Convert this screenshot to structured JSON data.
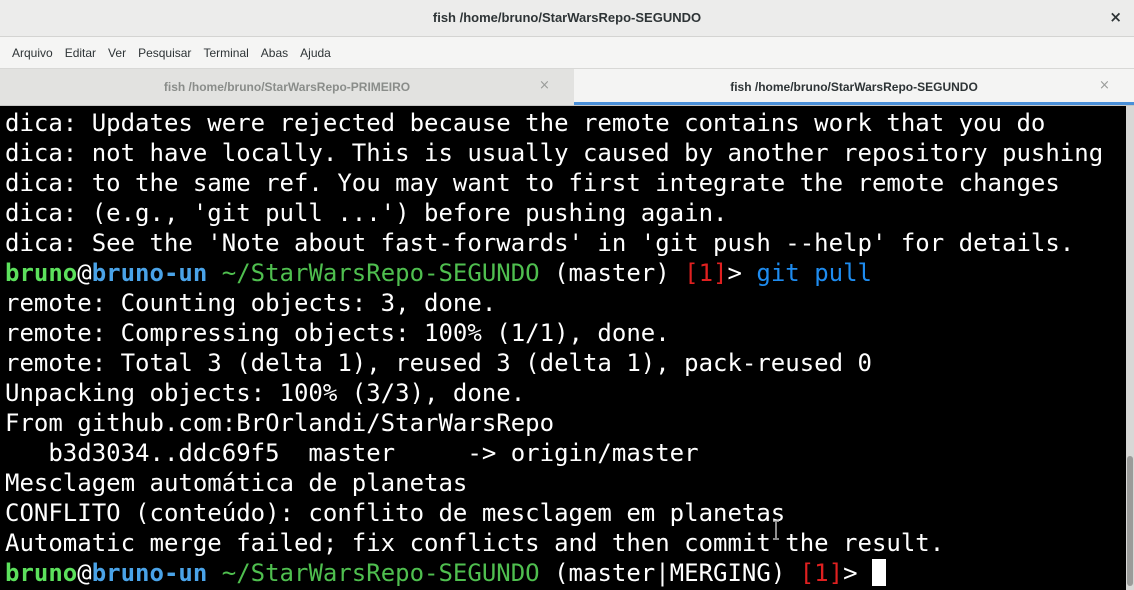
{
  "window": {
    "title": "fish  /home/bruno/StarWarsRepo-SEGUNDO",
    "close_glyph": "×"
  },
  "menu": {
    "items": [
      "Arquivo",
      "Editar",
      "Ver",
      "Pesquisar",
      "Terminal",
      "Abas",
      "Ajuda"
    ]
  },
  "tabs": [
    {
      "label": "fish  /home/bruno/StarWarsRepo-PRIMEIRO",
      "close_glyph": "×",
      "active": false
    },
    {
      "label": "fish  /home/bruno/StarWarsRepo-SEGUNDO",
      "close_glyph": "×",
      "active": true
    }
  ],
  "terminal": {
    "lines": [
      "dica: Updates were rejected because the remote contains work that you do",
      "dica: not have locally. This is usually caused by another repository pushing",
      "dica: to the same ref. You may want to first integrate the remote changes",
      "dica: (e.g., 'git pull ...') before pushing again.",
      "dica: See the 'Note about fast-forwards' in 'git push --help' for details."
    ],
    "prompt1": {
      "user": "bruno",
      "at": "@",
      "host": "bruno-un",
      "path": " ~/StarWarsRepo-SEGUNDO",
      "branch": " (master) ",
      "status": "[1]",
      "prompt": "> ",
      "command": "git pull"
    },
    "output": [
      "remote: Counting objects: 3, done.",
      "remote: Compressing objects: 100% (1/1), done.",
      "remote: Total 3 (delta 1), reused 3 (delta 1), pack-reused 0",
      "Unpacking objects: 100% (3/3), done.",
      "From github.com:BrOrlandi/StarWarsRepo",
      "   b3d3034..ddc69f5  master     -> origin/master",
      "Mesclagem automática de planetas",
      "CONFLITO (conteúdo): conflito de mesclagem em planetas",
      "Automatic merge failed; fix conflicts and then commit the result."
    ],
    "prompt2": {
      "user": "bruno",
      "at": "@",
      "host": "bruno-un",
      "path": " ~/StarWarsRepo-SEGUNDO",
      "branch": " (master|MERGING) ",
      "status": "[1]",
      "prompt": ">"
    }
  },
  "colors": {
    "terminal_bg": "#000000",
    "terminal_fg": "#ffffff",
    "user": "#5ce05c",
    "host": "#4aa3e8",
    "path": "#4fbf4f",
    "status": "#e02020",
    "command": "#1e8cf0",
    "active_tab_accent": "#4a90d9"
  }
}
